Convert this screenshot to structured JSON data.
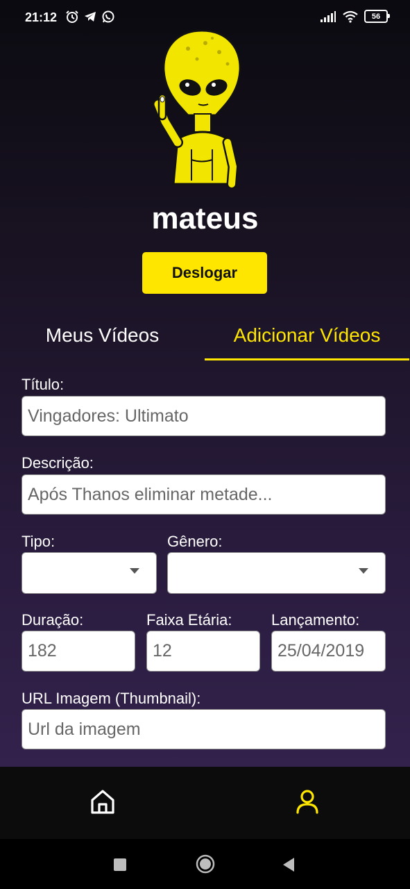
{
  "status_bar": {
    "time": "21:12",
    "battery": "56",
    "icons": [
      "alarm-icon",
      "telegram-icon",
      "whatsapp-icon",
      "signal-icon",
      "wifi-icon",
      "battery-icon"
    ]
  },
  "profile": {
    "username": "mateus",
    "logout_label": "Deslogar"
  },
  "tabs": [
    {
      "label": "Meus Vídeos",
      "active": false
    },
    {
      "label": "Adicionar Vídeos",
      "active": true
    }
  ],
  "form": {
    "title_label": "Título:",
    "title_placeholder": "Vingadores: Ultimato",
    "description_label": "Descrição:",
    "description_placeholder": "Após Thanos eliminar metade...",
    "type_label": "Tipo:",
    "genre_label": "Gênero:",
    "duration_label": "Duração:",
    "duration_placeholder": "182",
    "age_label": "Faixa Etária:",
    "age_placeholder": "12",
    "release_label": "Lançamento:",
    "release_placeholder": "25/04/2019",
    "thumbnail_label": "URL Imagem (Thumbnail):",
    "thumbnail_placeholder": "Url da imagem"
  },
  "bottom_nav": {
    "items": [
      {
        "icon": "home-icon",
        "active": false
      },
      {
        "icon": "user-icon",
        "active": true
      }
    ]
  },
  "colors": {
    "accent": "#ffe600",
    "background_top": "#0b0a10",
    "background_bottom": "#33224c"
  }
}
